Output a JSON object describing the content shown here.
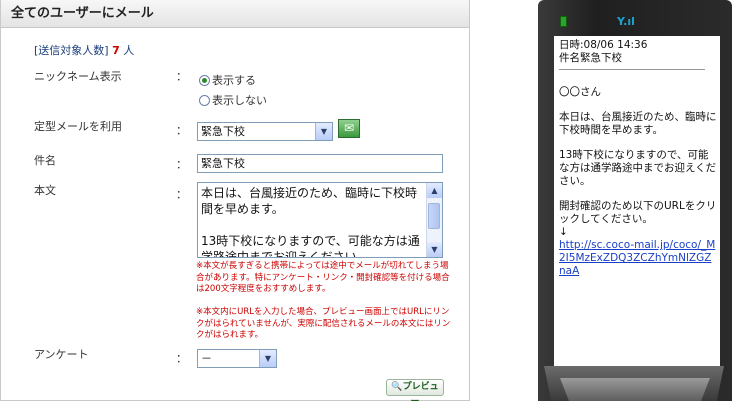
{
  "header": {
    "title": "全てのユーザーにメール"
  },
  "recipients": {
    "label": "[送信対象人数]",
    "count": "7",
    "unit": "人"
  },
  "nickname": {
    "label": "ニックネーム表示",
    "colon": "：",
    "options": [
      "表示する",
      "表示しない"
    ],
    "selected": 0
  },
  "template": {
    "label": "定型メールを利用",
    "colon": "：",
    "value": "緊急下校"
  },
  "subject": {
    "label": "件名",
    "colon": "：",
    "value": "緊急下校"
  },
  "body": {
    "label": "本文",
    "colon": "：",
    "value": "本日は、台風接近のため、臨時に下校時間を早めます。\n\n13時下校になりますので、可能な方は通学路途中までお迎えください。",
    "note1": "※本文が長すぎると携帯によっては途中でメールが切れてしまう場合があります。特にアンケート・リンク・開封確認等を付ける場合は200文字程度をおすすめします。",
    "note2": "※本文内にURLを入力した場合、プレビュー画面上ではURLにリンクがはられていませんが、実際に配信されるメールの本文にはリンクがはられます。"
  },
  "survey": {
    "label": "アンケート",
    "colon": "：",
    "value": "－"
  },
  "preview_button": {
    "label": "プレビュー"
  },
  "phone": {
    "date_line": "日時:08/06 14:36",
    "subject_line": "件名緊急下校",
    "greeting": "〇〇さん",
    "body1": "本日は、台風接近のため、臨時に下校時間を早めます。",
    "body2": "13時下校になりますので、可能な方は通学路途中までお迎えください。",
    "body3": "開封確認のため以下のURLをクリックしてください。",
    "arrow": "↓",
    "link": "http://sc.coco-mail.jp/coco/_M2I5MzExZDQ3ZCZhYmNlZGZnaA"
  },
  "colors": {
    "accent_red": "#cc0000",
    "link_blue": "#1a3ec7",
    "radio_green": "#2a8a2a"
  }
}
